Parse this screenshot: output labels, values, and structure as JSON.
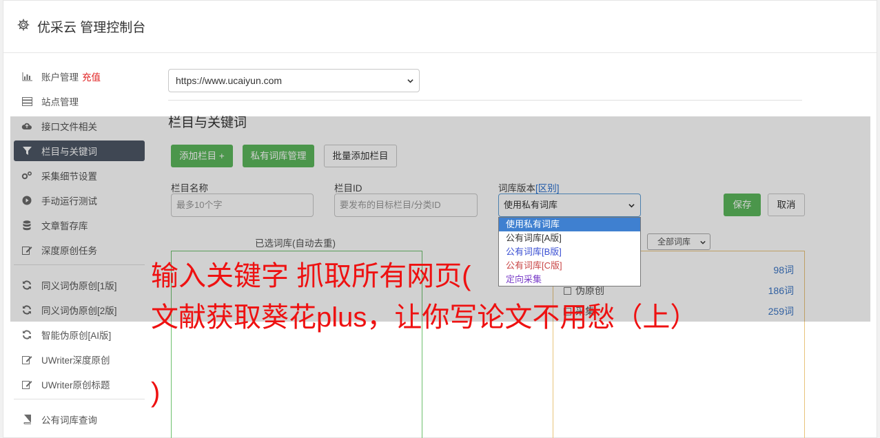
{
  "header": {
    "title": "优采云 管理控制台"
  },
  "sidebar": {
    "items": [
      {
        "label": "账户管理",
        "icon": "bar-chart-icon",
        "badge": "充值"
      },
      {
        "label": "站点管理",
        "icon": "server-icon"
      },
      {
        "label": "接口文件相关",
        "icon": "cloud-upload-icon"
      },
      {
        "label": "栏目与关键词",
        "icon": "filter-icon",
        "active": true
      },
      {
        "label": "采集细节设置",
        "icon": "gears-icon"
      },
      {
        "label": "手动运行测试",
        "icon": "play-circle-icon"
      },
      {
        "label": "文章暂存库",
        "icon": "database-icon"
      },
      {
        "label": "深度原创任务",
        "icon": "edit-icon"
      },
      {
        "label": "同义词伪原创[1版]",
        "icon": "refresh-icon"
      },
      {
        "label": "同义词伪原创[2版]",
        "icon": "refresh-icon"
      },
      {
        "label": "智能伪原创[AI版]",
        "icon": "refresh-icon"
      },
      {
        "label": "UWriter深度原创",
        "icon": "edit-icon"
      },
      {
        "label": "UWriter原创标题",
        "icon": "edit-icon"
      },
      {
        "label": "公有词库查询",
        "icon": "book-icon"
      }
    ]
  },
  "main": {
    "site_select_value": "https://www.ucaiyun.com",
    "section_title": "栏目与关键词",
    "buttons": {
      "add_column": "添加栏目 +",
      "private_lib": "私有词库管理",
      "batch_add": "批量添加栏目",
      "save": "保存",
      "cancel": "取消"
    },
    "fields": {
      "name_label": "栏目名称",
      "name_placeholder": "最多10个字",
      "id_label": "栏目ID",
      "id_placeholder": "要发布的目标栏目/分类ID",
      "version_label": "词库版本",
      "version_label_link": "[区别]",
      "version_value": "使用私有词库"
    },
    "version_options": [
      "使用私有词库",
      "公有词库[A版]",
      "公有词库[B版]",
      "公有词库[C版]",
      "定向采集"
    ],
    "selected_lib_label": "已选词库(自动去重)",
    "filter_value": "全部词库",
    "lib_rows": [
      {
        "label": "",
        "count": "98词"
      },
      {
        "label": "伪原创",
        "count": "186词"
      },
      {
        "label": "采集",
        "count": "259词"
      }
    ]
  },
  "caption": {
    "line1": "输入关键字 抓取所有网页(",
    "line2": "文献获取葵花plus，让你写论文不用愁（上）",
    "line3": ")"
  },
  "colors": {
    "accent_green": "#5cb85c",
    "sidebar_active": "#4d5766",
    "caption_red": "#ee1111",
    "badge_red": "#e02020"
  }
}
